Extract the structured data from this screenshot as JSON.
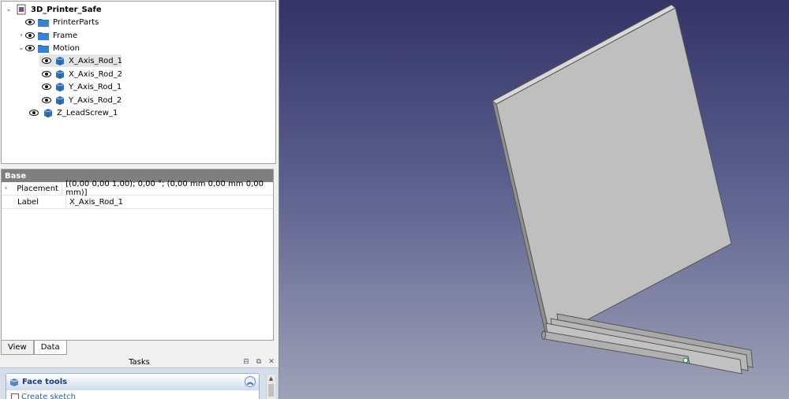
{
  "tree": {
    "root": "3D_Printer_Safe",
    "items": [
      {
        "label": "PrinterParts"
      },
      {
        "label": "Frame"
      },
      {
        "label": "Motion"
      },
      {
        "label": "X_Axis_Rod_1"
      },
      {
        "label": "X_Axis_Rod_2"
      },
      {
        "label": "Y_Axis_Rod_1"
      },
      {
        "label": "Y_Axis_Rod_2"
      },
      {
        "label": "Z_LeadScrew_1"
      }
    ]
  },
  "properties": {
    "group": "Base",
    "rows": [
      {
        "name": "Placement",
        "value": "[(0,00 0,00 1,00); 0,00 °; (0,00 mm  0,00 mm  0,00 mm)]"
      },
      {
        "name": "Label",
        "value": "X_Axis_Rod_1"
      }
    ]
  },
  "view_tabs": {
    "view": "View",
    "data": "Data"
  },
  "tasks": {
    "title": "Tasks",
    "panel_title": "Face tools",
    "link": "Create sketch"
  },
  "colors": {
    "tree_selection": "#e5e5e5",
    "property_group": "#7f7f7f",
    "viewport_top": "#333366",
    "viewport_bottom": "#9fa2b8",
    "part_face": "#bfbfbf"
  }
}
